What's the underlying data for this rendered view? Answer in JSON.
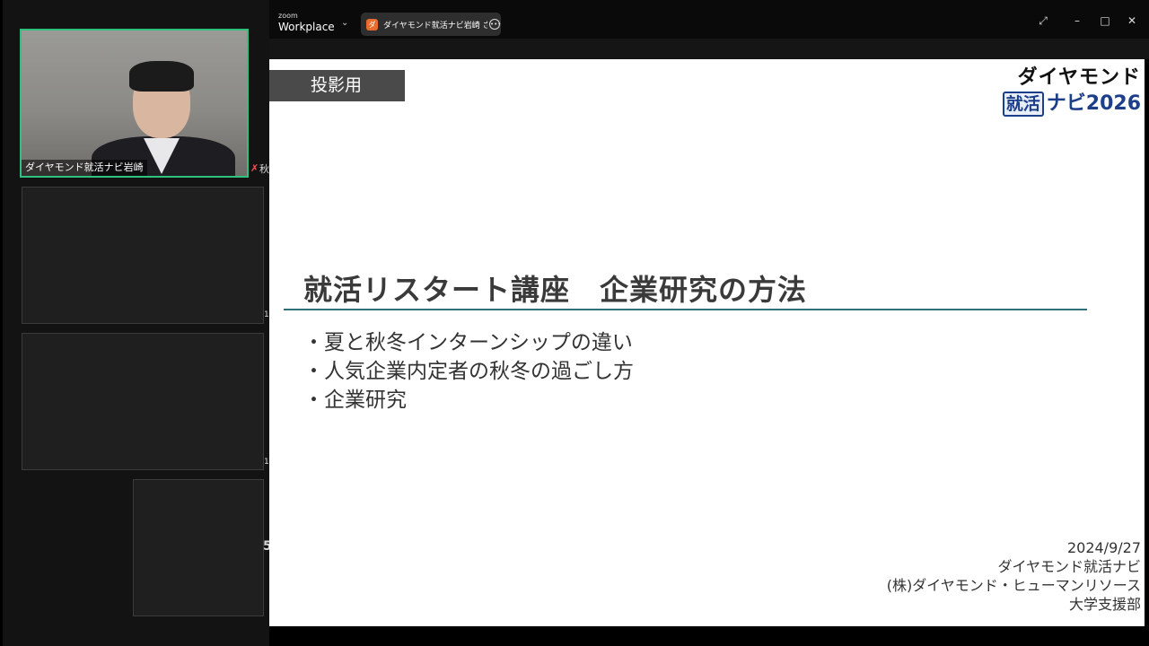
{
  "app": {
    "brand_small": "zoom",
    "brand_name": "Workplace",
    "share_tab_label": "ダイヤモンド就活ナビ岩崎 さんの画面",
    "share_tab_icon_text": "ダ"
  },
  "gallery": {
    "main_participant_name": "ダイヤモンド就活ナビ岩崎",
    "cut_label_top": "秋",
    "cut_label_mid1": "1",
    "cut_label_mid2": "1",
    "cut_label_bottom": "5"
  },
  "slide": {
    "tag": "投影用",
    "logo_line1": "ダイヤモンド",
    "logo_boxed": "就活",
    "logo_tail": "ナビ2026",
    "title": "就活リスタート講座　企業研究の方法",
    "bullets": [
      "夏と秋冬インターンシップの違い",
      "人気企業内定者の秋冬の過ごし方",
      "企業研究"
    ],
    "footer": {
      "date": "2024/9/27",
      "line2": "ダイヤモンド就活ナビ",
      "line3": "(株)ダイヤモンド・ヒューマンリソース",
      "line4": "大学支援部"
    }
  },
  "colors": {
    "active_speaker_border": "#2ec27e",
    "title_rule": "#2f6f78",
    "logo_blue": "#1d3f8a",
    "share_icon": "#e86b2c"
  }
}
